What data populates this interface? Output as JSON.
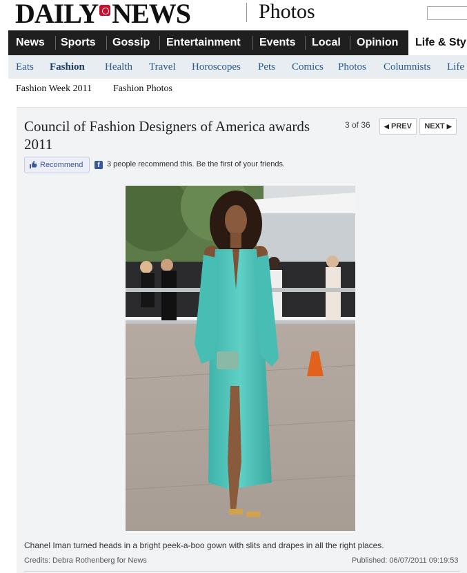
{
  "masthead": {
    "logo_left": "DAILY",
    "logo_right": "NEWS",
    "section": "Photos"
  },
  "main_nav": {
    "items": [
      "News",
      "Sports",
      "Gossip",
      "Entertainment",
      "Events",
      "Local",
      "Opinion",
      "Life & Sty"
    ]
  },
  "sub_nav": {
    "items": [
      "Eats",
      "Fashion",
      "Health",
      "Travel",
      "Horoscopes",
      "Pets",
      "Comics",
      "Photos",
      "Columnists",
      "Life &"
    ]
  },
  "tert_nav": {
    "items": [
      "Fashion Week 2011",
      "Fashion Photos"
    ]
  },
  "gallery": {
    "title": "Council of Fashion Designers of America awards 2011",
    "counter": "3 of 36",
    "prev_label": "PREV",
    "next_label": "NEXT"
  },
  "social": {
    "recommend_label": "Recommend",
    "recommend_text": "3 people recommend this. Be the first of your friends."
  },
  "photo": {
    "caption": "Chanel Iman turned heads in a bright peek-a-boo gown with slits and drapes in all the right places.",
    "credits": "Credits: Debra Rothenberg for News",
    "published": "Published: 06/07/2011 09:19:53"
  },
  "colors": {
    "nav_bg": "#1f1f1f",
    "subnav_bg": "#e8edf2",
    "link": "#2a5b8c",
    "facebook": "#3b5998",
    "dress": "#4fc2b9"
  }
}
